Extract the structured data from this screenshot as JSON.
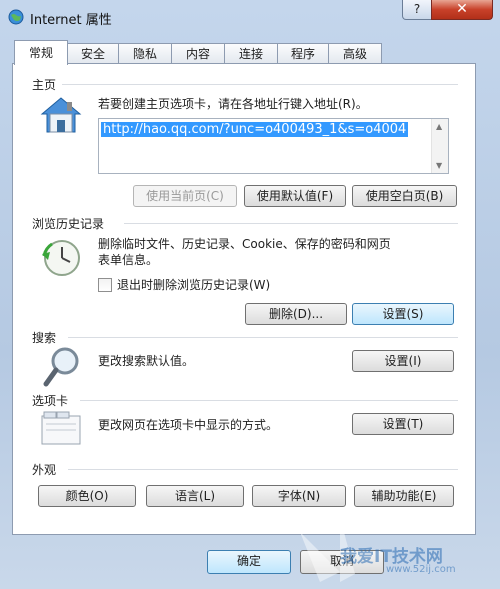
{
  "window": {
    "title": "Internet 属性",
    "help_label": "?",
    "close_label": "✕"
  },
  "tabs": [
    {
      "label": "常规",
      "active": true
    },
    {
      "label": "安全"
    },
    {
      "label": "隐私"
    },
    {
      "label": "内容"
    },
    {
      "label": "连接"
    },
    {
      "label": "程序"
    },
    {
      "label": "高级"
    }
  ],
  "homepage": {
    "heading": "主页",
    "instruction": "若要创建主页选项卡，请在各地址行键入地址(R)。",
    "url": "http://hao.qq.com/?unc=o400493_1&s=o4004",
    "icon": "house-icon",
    "buttons": {
      "use_current": "使用当前页(C)",
      "use_default": "使用默认值(F)",
      "use_blank": "使用空白页(B)"
    }
  },
  "history": {
    "heading": "浏览历史记录",
    "description_line1": "删除临时文件、历史记录、Cookie、保存的密码和网页",
    "description_line2": "表单信息。",
    "checkbox_label": "退出时删除浏览历史记录(W)",
    "checkbox_checked": false,
    "icon": "clock-icon",
    "delete_button": "删除(D)...",
    "settings_button": "设置(S)"
  },
  "search": {
    "heading": "搜索",
    "description": "更改搜索默认值。",
    "icon": "magnifier-icon",
    "settings_button": "设置(I)"
  },
  "tabs_section": {
    "heading": "选项卡",
    "description": "更改网页在选项卡中显示的方式。",
    "icon": "tabs-window-icon",
    "settings_button": "设置(T)"
  },
  "appearance": {
    "heading": "外观",
    "buttons": {
      "colors": "颜色(O)",
      "languages": "语言(L)",
      "fonts": "字体(N)",
      "accessibility": "辅助功能(E)"
    }
  },
  "footer": {
    "ok": "确定",
    "cancel": "取消"
  },
  "watermark": {
    "text1": "我爱IT技术网",
    "text2": "www.52ij.com"
  },
  "colors": {
    "selection": "#3399ff",
    "close_red": "#c8412a",
    "frame_blue": "#b5c9e2"
  }
}
